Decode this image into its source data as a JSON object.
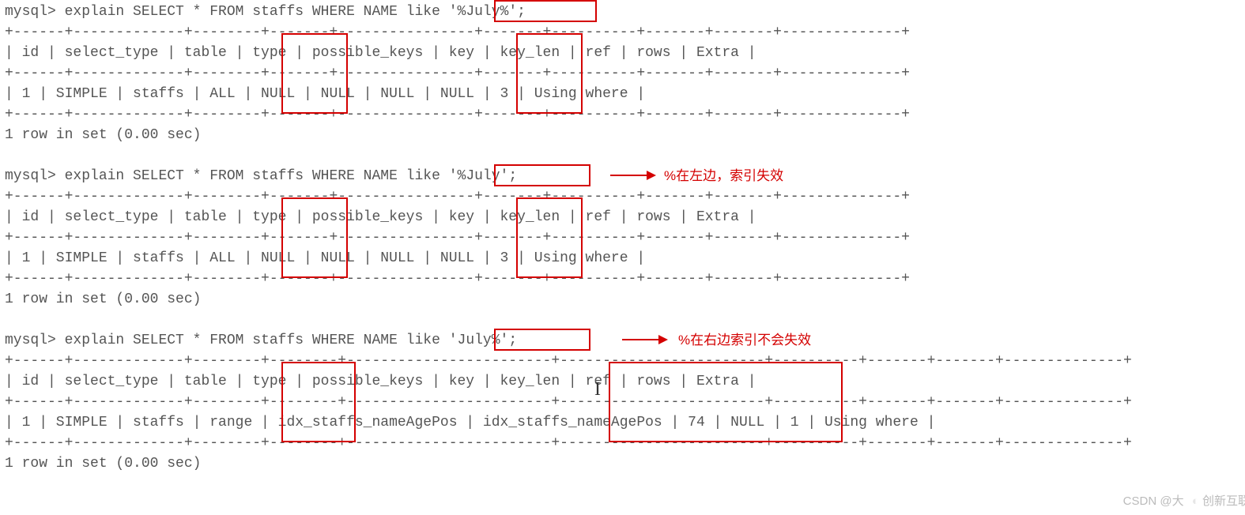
{
  "q1": {
    "prompt": "mysql> ",
    "pre": "explain SELECT * FROM staffs WHERE NAME like ",
    "quoted": "'%July%'",
    "post": ";",
    "border": "+------+-------------+--------+-------+----------------+-------+----------+-------+-------+--------------+",
    "headerrow": "| id   | select_type | table  | type  | possible_keys  | key   | key_len  | ref   | rows  | Extra        |",
    "datarow": "|  1   | SIMPLE      | staffs | ALL   | NULL           | NULL  | NULL     | NULL  |    3  | Using where  |",
    "footer": "1 row in set (0.00 sec)"
  },
  "q2": {
    "prompt": "mysql> ",
    "pre": "explain SELECT * FROM staffs WHERE NAME like ",
    "quoted": "'%July'",
    "post": ";",
    "border": "+------+-------------+--------+-------+----------------+-------+----------+-------+-------+--------------+",
    "headerrow": "| id   | select_type | table  | type  | possible_keys  | key   | key_len  | ref   | rows  | Extra        |",
    "datarow": "|  1   | SIMPLE      | staffs | ALL   | NULL           | NULL  | NULL     | NULL  |    3  | Using where  |",
    "footer": "1 row in set (0.00 sec)",
    "note": "%在左边，索引失效"
  },
  "q3": {
    "prompt": "mysql> ",
    "pre": "explain SELECT * FROM staffs WHERE NAME like ",
    "quoted": "'July%'",
    "post": ";",
    "border": "+------+-------------+--------+--------+------------------------+------------------------+----------+-------+-------+--------------+",
    "headerrow": "| id   | select_type | table  | type   | possible_keys          | key                    | key_len  | ref   | rows  | Extra        |",
    "datarow": "|  1   | SIMPLE      | staffs | range  | idx_staffs_nameAgePos  | idx_staffs_nameAgePos  | 74       | NULL  |    1  | Using where  |",
    "footer": "1 row in set (0.00 sec)",
    "note": "%在右边索引不会失效"
  },
  "watermark": "CSDN @大",
  "logo": "创新互联"
}
